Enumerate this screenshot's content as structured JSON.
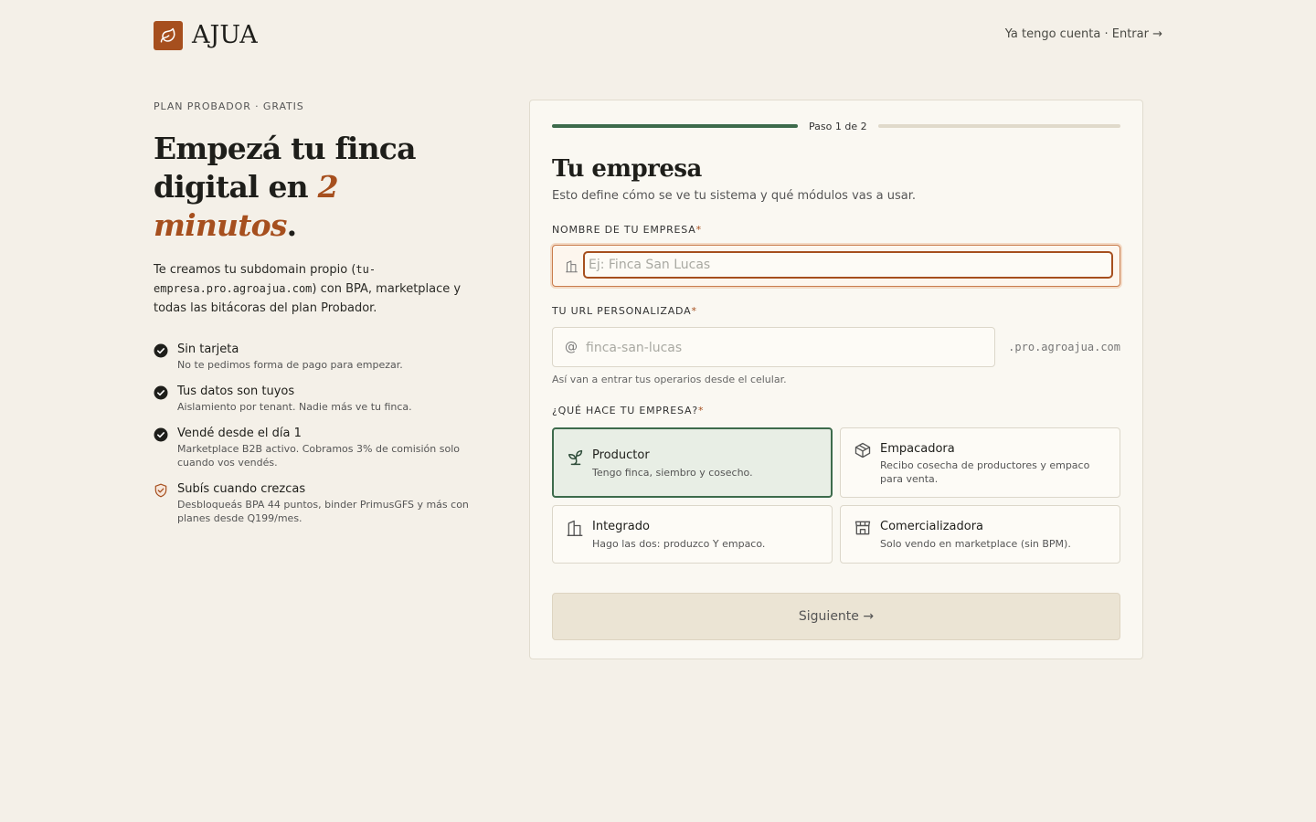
{
  "header": {
    "brand": "AJUA",
    "login_link": "Ya tengo cuenta · Entrar →"
  },
  "hero": {
    "eyebrow": "PLAN PROBADOR · GRATIS",
    "headline_part1": "Empezá tu finca digital en ",
    "headline_highlight": "2 minutos",
    "headline_end": ".",
    "intro_before": "Te creamos tu subdomain propio (",
    "intro_code": "tu-empresa.pro.agroajua.com",
    "intro_after": ") con BPA, marketplace y todas las bitácoras del plan Probador."
  },
  "features": [
    {
      "title": "Sin tarjeta",
      "desc": "No te pedimos forma de pago para empezar.",
      "icon": "check-circle-icon"
    },
    {
      "title": "Tus datos son tuyos",
      "desc": "Aislamiento por tenant. Nadie más ve tu finca.",
      "icon": "check-circle-icon"
    },
    {
      "title": "Vendé desde el día 1",
      "desc": "Marketplace B2B activo. Cobramos 3% de comisión solo cuando vos vendés.",
      "icon": "check-circle-icon"
    },
    {
      "title": "Subís cuando crezcas",
      "desc": "Desbloqueás BPA 44 puntos, binder PrimusGFS y más con planes desde Q199/mes.",
      "icon": "shield-check-icon"
    }
  ],
  "form": {
    "step_label": "Paso 1 de 2",
    "progress": 0.5,
    "title": "Tu empresa",
    "subtitle": "Esto define cómo se ve tu sistema y qué módulos vas a usar.",
    "name_label": "NOMBRE DE TU EMPRESA",
    "name_value": "",
    "name_placeholder": "Ej: Finca San Lucas",
    "url_label": "TU URL PERSONALIZADA",
    "url_prefix": "@",
    "url_value": "",
    "url_placeholder": "finca-san-lucas",
    "url_suffix": ".pro.agroajua.com",
    "url_help": "Así van a entrar tus operarios desde el celular.",
    "type_label": "¿QUÉ HACE TU EMPRESA?",
    "required_mark": "*",
    "options": [
      {
        "title": "Productor",
        "desc": "Tengo finca, siembro y cosecho.",
        "icon": "sprout-icon",
        "selected": true
      },
      {
        "title": "Empacadora",
        "desc": "Recibo cosecha de productores y empaco para venta.",
        "icon": "box-icon",
        "selected": false
      },
      {
        "title": "Integrado",
        "desc": "Hago las dos: produzco Y empaco.",
        "icon": "building-icon",
        "selected": false
      },
      {
        "title": "Comercializadora",
        "desc": "Solo vendo en marketplace (sin BPM).",
        "icon": "store-icon",
        "selected": false
      }
    ],
    "next_label": "Siguiente →"
  },
  "colors": {
    "background": "#f4f0e8",
    "brand": "#a64f1e",
    "accent_green": "#3d6b4c",
    "card": "#faf8f2"
  }
}
